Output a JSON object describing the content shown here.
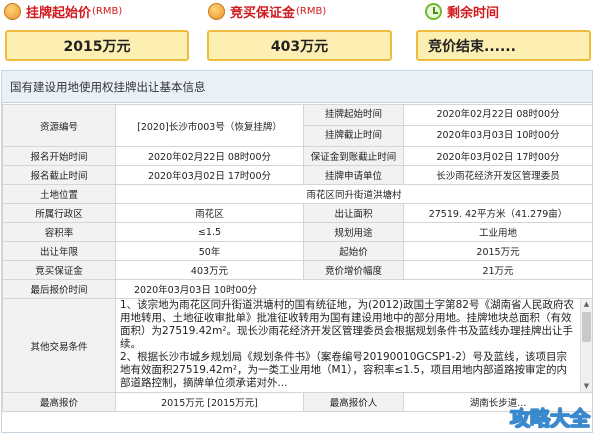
{
  "summary": {
    "start_price": {
      "title": "挂牌起始价",
      "unit": "(RMB)",
      "value": "2015万元"
    },
    "deposit": {
      "title": "竞买保证金",
      "unit": "(RMB)",
      "value": "403万元"
    },
    "time_left": {
      "title": "剩余时间",
      "value": "竞价结束......"
    }
  },
  "panel_title": "国有建设用地使用权挂牌出让基本信息",
  "rows": {
    "r1": {
      "l1": "资源编号",
      "v1": "[2020]长沙市003号（恢复挂牌）",
      "l2a": "挂牌起始时间",
      "v2a": "2020年02月22日 08时00分",
      "l2b": "挂牌截止时间",
      "v2b": "2020年03月03日 10时00分"
    },
    "r2": {
      "l1": "报名开始时间",
      "v1": "2020年02月22日 08时00分",
      "l2": "保证金到账截止时间",
      "v2": "2020年03月02日 17时00分"
    },
    "r3": {
      "l1": "报名截止时间",
      "v1": "2020年03月02日 17时00分",
      "l2": "挂牌申请单位",
      "v2": "长沙雨花经济开发区管理委员"
    },
    "r4": {
      "l1": "土地位置",
      "v1": "雨花区同升街道洪塘村"
    },
    "r5": {
      "l1": "所属行政区",
      "v1": "雨花区",
      "l2": "出让面积",
      "v2": "27519. 42平方米（41.279亩）"
    },
    "r6": {
      "l1": "容积率",
      "v1": "≤1.5",
      "l2": "规划用途",
      "v2": "工业用地"
    },
    "r7": {
      "l1": "出让年限",
      "v1": "50年",
      "l2": "起始价",
      "v2": "2015万元"
    },
    "r8": {
      "l1": "竞买保证金",
      "v1": "403万元",
      "l2": "竞价增价幅度",
      "v2": "21万元"
    },
    "r9": {
      "l1": "最后报价时间",
      "v1": "2020年03月03日 10时00分"
    },
    "r10": {
      "l1": "其他交易条件",
      "text": "1、该宗地为雨花区同升街道洪塘村的国有统征地，为(2012)政国土字第82号《湖南省人民政府农用地转用、土地征收审批单》批准征收转用为国有建设用地中的部分用地。挂牌地块总面积（有效面积）为27519.42m²。现长沙雨花经济开发区管理委员会根据规划条件书及蓝线办理挂牌出让手续。\n2、根据长沙市城乡规划局《规划条件书》（案卷编号20190010GCSP1-2）号及蓝线，该项目宗地有效面积27519.42m²，为一类工业用地（M1），容积率≤1.5，项目用地内部道路按审定的内部道路控制，摘牌单位须承诺对外..."
    },
    "r11": {
      "l1": "最高报价",
      "v1": "2015万元 [2015万元]",
      "l2": "最高报价人",
      "v2": "湖南长步道..."
    }
  },
  "scrollbar": {
    "up": "▲",
    "down": "▼"
  },
  "watermark": "攻略大全",
  "colors": {
    "title_red": "#d2181c",
    "box_fill": "#fdefb2",
    "box_border": "#eebd3d",
    "panel_head": "#e9f0f7"
  },
  "icons": {
    "price": "money-bag-icon",
    "deposit": "money-bag-icon",
    "time": "clock-icon"
  }
}
